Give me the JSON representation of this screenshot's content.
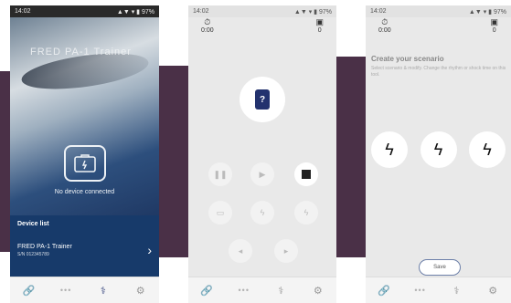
{
  "screen1": {
    "status_time": "14:02",
    "status_right": "▲▼ ▾ ▮ 97%",
    "brand": "FRED PA-1 Trainer",
    "no_device_text": "No device connected",
    "device_list_title": "Device list",
    "device": {
      "name": "FRED PA-1 Trainer",
      "serial": "S/N 012345789"
    }
  },
  "screen2": {
    "status_time": "14:02",
    "status_right": "▲▼ ▾ ▮ 97%",
    "timer": "0:00",
    "counter": "0"
  },
  "screen3": {
    "status_time": "14:02",
    "status_right": "▲▼ ▾ ▮ 97%",
    "timer": "0:00",
    "counter": "0",
    "title": "Create your scenario",
    "subtitle": "Select scenario & modify. Change the rhythm or shock time on this tool.",
    "save_label": "Save"
  },
  "colors": {
    "band": "#4a3047",
    "brand_dark": "#173a6a",
    "device_blue": "#23326e"
  },
  "icons": [
    "link-icon",
    "more-dots-icon",
    "device-add-icon",
    "settings-icon"
  ]
}
